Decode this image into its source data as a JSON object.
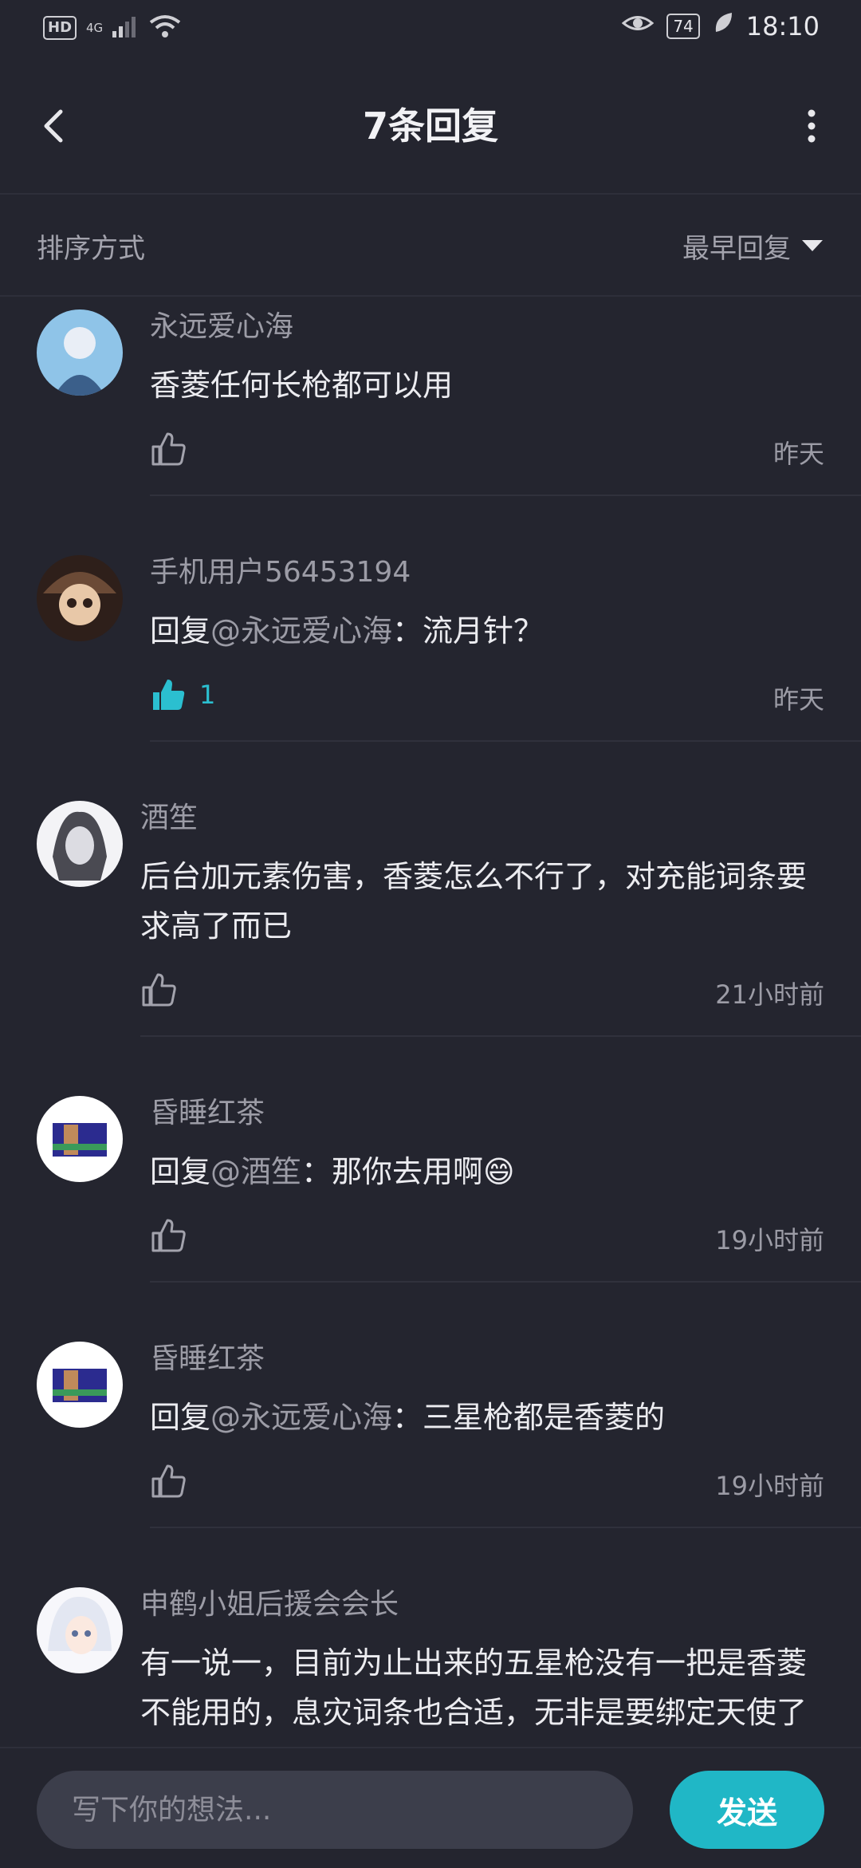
{
  "status_bar": {
    "hd": "HD",
    "network": "4G",
    "battery": "74",
    "time": "18:10"
  },
  "header": {
    "title": "7条回复",
    "back_icon": "back-arrow-icon",
    "more_icon": "more-vertical-icon"
  },
  "sort": {
    "label": "排序方式",
    "selected": "最早回复"
  },
  "comments": [
    {
      "username": "永远爱心海",
      "reply_prefix": "",
      "mention": "",
      "text": "香菱任何长枪都可以用",
      "likes": "",
      "liked": false,
      "time": "昨天",
      "avatar_colors": [
        "#8fc4e8",
        "#e9eef6",
        "#3b5f8a"
      ]
    },
    {
      "username": "手机用户56453194",
      "reply_prefix": "回复",
      "mention": "@永远爱心海",
      "text": "：流月针？",
      "likes": "1",
      "liked": true,
      "time": "昨天",
      "avatar_colors": [
        "#6b4a36",
        "#e8c8a8",
        "#2e1f1a"
      ]
    },
    {
      "username": "酒笙",
      "reply_prefix": "",
      "mention": "",
      "text": "后台加元素伤害，香菱怎么不行了，对充能词条要求高了而已",
      "likes": "",
      "liked": false,
      "time": "21小时前",
      "avatar_colors": [
        "#dcdce2",
        "#4a4a52",
        "#f3f3f6"
      ]
    },
    {
      "username": "昏睡红茶",
      "reply_prefix": "回复",
      "mention": "@酒笙",
      "text": "：那你去用啊😄",
      "likes": "",
      "liked": false,
      "time": "19小时前",
      "avatar_colors": [
        "#ffffff",
        "#2b2b8f",
        "#c08a5a"
      ]
    },
    {
      "username": "昏睡红茶",
      "reply_prefix": "回复",
      "mention": "@永远爱心海",
      "text": "：三星枪都是香菱的",
      "likes": "",
      "liked": false,
      "time": "19小时前",
      "avatar_colors": [
        "#ffffff",
        "#2b2b8f",
        "#c08a5a"
      ]
    },
    {
      "username": "申鹤小姐后援会会长",
      "reply_prefix": "",
      "mention": "",
      "text": "有一说一，目前为止出来的五星枪没有一把是香菱不能用的，息灾词条也合适，无非是要绑定天使了而已",
      "likes": "",
      "liked": false,
      "time": "",
      "avatar_colors": [
        "#e3e7f2",
        "#5b6f9a",
        "#f7f7fb"
      ]
    }
  ],
  "input": {
    "placeholder": "写下你的想法..."
  },
  "send_label": "发送",
  "colors": {
    "background": "#24252f",
    "accent": "#20b7c6",
    "liked": "#2bbfd0"
  }
}
